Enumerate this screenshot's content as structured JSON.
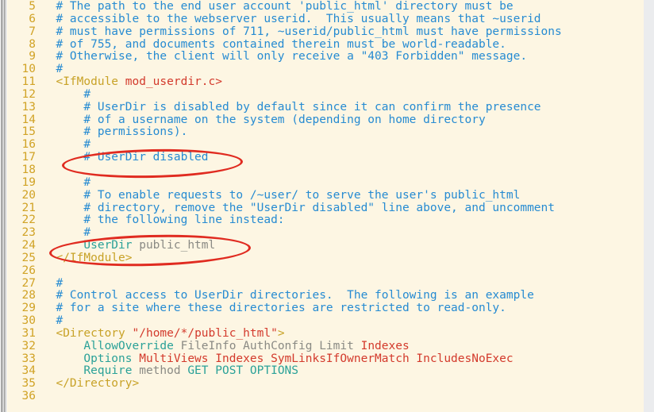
{
  "editor": {
    "file_type": "apache-config",
    "background_color": "#fdf6e3",
    "line_number_color": "#d1a326",
    "first_line_number": 5,
    "last_line_number": 36
  },
  "annotations": {
    "color": "#e02b20",
    "shape": "ellipse",
    "items": [
      {
        "id": "annot-userdir-disabled",
        "target_line": 17,
        "target_text": "# UserDir disabled"
      },
      {
        "id": "annot-userdir-publichtml",
        "target_line": 24,
        "target_text": "UserDir public_html"
      }
    ]
  },
  "code": {
    "lines": [
      {
        "n": "5",
        "tokens": [
          {
            "c": "t-comment",
            "s": "  # The path to the end user account 'public_html' directory must be"
          }
        ]
      },
      {
        "n": "6",
        "tokens": [
          {
            "c": "t-comment",
            "s": "  # accessible to the webserver userid.  This usually means that ~userid"
          }
        ]
      },
      {
        "n": "7",
        "tokens": [
          {
            "c": "t-comment",
            "s": "  # must have permissions of 711, ~userid/public_html must have permissions"
          }
        ]
      },
      {
        "n": "8",
        "tokens": [
          {
            "c": "t-comment",
            "s": "  # of 755, and documents contained therein must be world-readable."
          }
        ]
      },
      {
        "n": "9",
        "tokens": [
          {
            "c": "t-comment",
            "s": "  # Otherwise, the client will only receive a \"403 Forbidden\" message."
          }
        ]
      },
      {
        "n": "10",
        "tokens": [
          {
            "c": "t-comment",
            "s": "  #"
          }
        ]
      },
      {
        "n": "11",
        "tokens": [
          {
            "c": "t-tag",
            "s": "  <IfModule "
          },
          {
            "c": "t-module",
            "s": "mod_userdir.c>"
          }
        ]
      },
      {
        "n": "12",
        "tokens": [
          {
            "c": "t-comment",
            "s": "      #"
          }
        ]
      },
      {
        "n": "13",
        "tokens": [
          {
            "c": "t-comment",
            "s": "      # UserDir is disabled by default since it can confirm the presence"
          }
        ]
      },
      {
        "n": "14",
        "tokens": [
          {
            "c": "t-comment",
            "s": "      # of a username on the system (depending on home directory"
          }
        ]
      },
      {
        "n": "15",
        "tokens": [
          {
            "c": "t-comment",
            "s": "      # permissions)."
          }
        ]
      },
      {
        "n": "16",
        "tokens": [
          {
            "c": "t-comment",
            "s": "      #"
          }
        ]
      },
      {
        "n": "17",
        "tokens": [
          {
            "c": "t-comment",
            "s": "      # UserDir disabled"
          }
        ]
      },
      {
        "n": "18",
        "tokens": [
          {
            "c": "t-plain",
            "s": ""
          }
        ]
      },
      {
        "n": "19",
        "tokens": [
          {
            "c": "t-comment",
            "s": "      #"
          }
        ]
      },
      {
        "n": "20",
        "tokens": [
          {
            "c": "t-comment",
            "s": "      # To enable requests to /~user/ to serve the user's public_html"
          }
        ]
      },
      {
        "n": "21",
        "tokens": [
          {
            "c": "t-comment",
            "s": "      # directory, remove the \"UserDir disabled\" line above, and uncomment"
          }
        ]
      },
      {
        "n": "22",
        "tokens": [
          {
            "c": "t-comment",
            "s": "      # the following line instead:"
          }
        ]
      },
      {
        "n": "23",
        "tokens": [
          {
            "c": "t-comment",
            "s": "      #"
          }
        ]
      },
      {
        "n": "24",
        "tokens": [
          {
            "c": "t-keyword",
            "s": "      UserDir "
          },
          {
            "c": "t-value",
            "s": "public_html"
          }
        ]
      },
      {
        "n": "25",
        "tokens": [
          {
            "c": "t-tag",
            "s": "  </IfModule>"
          }
        ]
      },
      {
        "n": "26",
        "tokens": [
          {
            "c": "t-plain",
            "s": ""
          }
        ]
      },
      {
        "n": "27",
        "tokens": [
          {
            "c": "t-comment",
            "s": "  #"
          }
        ]
      },
      {
        "n": "28",
        "tokens": [
          {
            "c": "t-comment",
            "s": "  # Control access to UserDir directories.  The following is an example"
          }
        ]
      },
      {
        "n": "29",
        "tokens": [
          {
            "c": "t-comment",
            "s": "  # for a site where these directories are restricted to read-only."
          }
        ]
      },
      {
        "n": "30",
        "tokens": [
          {
            "c": "t-comment",
            "s": "  #"
          }
        ]
      },
      {
        "n": "31",
        "tokens": [
          {
            "c": "t-tag",
            "s": "  <Directory "
          },
          {
            "c": "t-string",
            "s": "\"/home/*/public_html\""
          },
          {
            "c": "t-tag",
            "s": ">"
          }
        ]
      },
      {
        "n": "32",
        "tokens": [
          {
            "c": "t-keyword",
            "s": "      AllowOverride "
          },
          {
            "c": "t-value",
            "s": "FileInfo AuthConfig Limit "
          },
          {
            "c": "t-option",
            "s": "Indexes"
          }
        ]
      },
      {
        "n": "33",
        "tokens": [
          {
            "c": "t-keyword",
            "s": "      Options "
          },
          {
            "c": "t-option",
            "s": "MultiViews Indexes SymLinksIfOwnerMatch IncludesNoExec"
          }
        ]
      },
      {
        "n": "34",
        "tokens": [
          {
            "c": "t-keyword",
            "s": "      Require "
          },
          {
            "c": "t-value",
            "s": "method "
          },
          {
            "c": "t-keyword",
            "s": "GET POST OPTIONS"
          }
        ]
      },
      {
        "n": "35",
        "tokens": [
          {
            "c": "t-tag",
            "s": "  </Directory>"
          }
        ]
      },
      {
        "n": "36",
        "tokens": [
          {
            "c": "t-plain",
            "s": ""
          }
        ]
      }
    ]
  }
}
